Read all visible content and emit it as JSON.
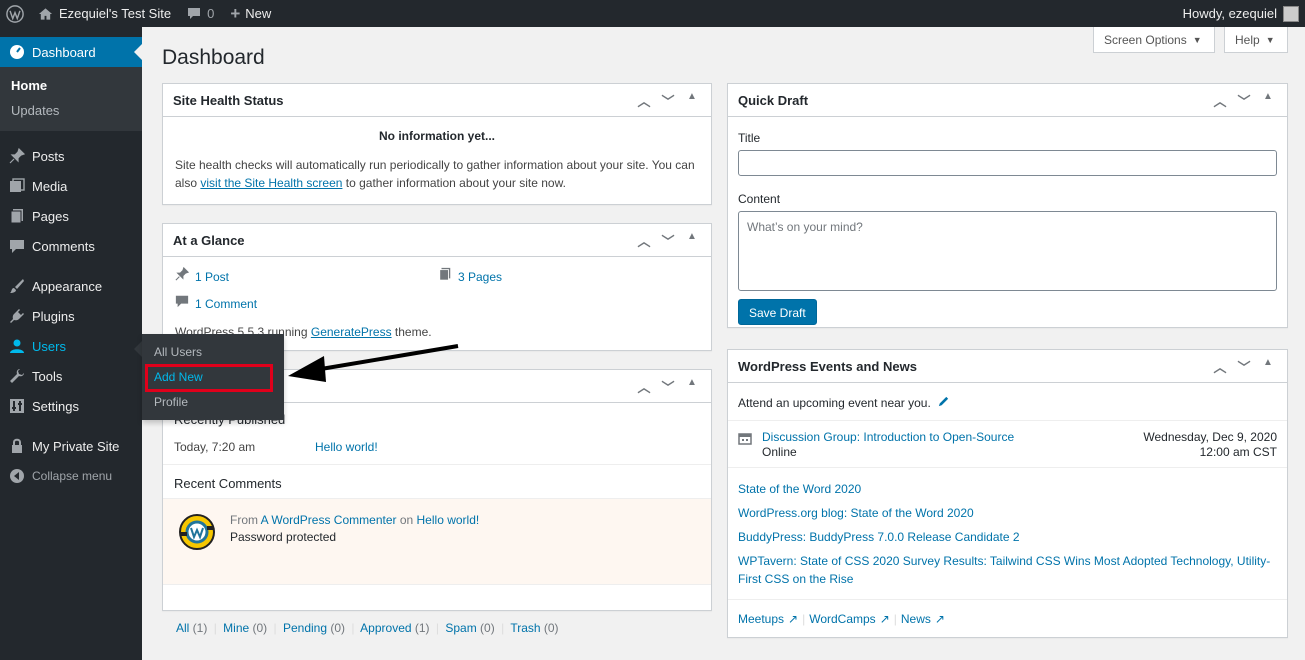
{
  "adminbar": {
    "site_name": "Ezequiel's Test Site",
    "comments_count": "0",
    "new_label": "New",
    "howdy": "Howdy, ezequiel"
  },
  "sidebar": {
    "dashboard": "Dashboard",
    "home": "Home",
    "updates": "Updates",
    "posts": "Posts",
    "media": "Media",
    "pages": "Pages",
    "comments": "Comments",
    "appearance": "Appearance",
    "plugins": "Plugins",
    "users": "Users",
    "tools": "Tools",
    "settings": "Settings",
    "private_site": "My Private Site",
    "collapse": "Collapse menu"
  },
  "users_flyout": {
    "all_users": "All Users",
    "add_new": "Add New",
    "profile": "Profile"
  },
  "header": {
    "title": "Dashboard",
    "screen_options": "Screen Options",
    "help": "Help"
  },
  "site_health": {
    "title": "Site Health Status",
    "no_info": "No information yet...",
    "text_before": "Site health checks will automatically run periodically to gather information about your site. You can also ",
    "link": "visit the Site Health screen",
    "text_after": " to gather information about your site now."
  },
  "at_a_glance": {
    "title": "At a Glance",
    "posts": "1 Post",
    "pages": "3 Pages",
    "comments": "1 Comment",
    "theme_prefix": "WordPress 5.5.3 running ",
    "theme_link": "GeneratePress",
    "theme_suffix": " theme."
  },
  "activity": {
    "recently_published": "Recently Published",
    "published_time": "Today, 7:20 am",
    "published_link": "Hello world!",
    "recent_comments": "Recent Comments",
    "comment_from": "From ",
    "commenter": "A WordPress Commenter",
    "on": " on ",
    "comment_post": "Hello world!",
    "password_protected": "Password protected",
    "filters": [
      {
        "label": "All",
        "count": " (1)"
      },
      {
        "label": "Mine",
        "count": " (0)"
      },
      {
        "label": "Pending",
        "count": " (0)"
      },
      {
        "label": "Approved",
        "count": " (1)"
      },
      {
        "label": "Spam",
        "count": " (0)"
      },
      {
        "label": "Trash",
        "count": " (0)"
      }
    ]
  },
  "quick_draft": {
    "title": "Quick Draft",
    "title_label": "Title",
    "content_label": "Content",
    "content_placeholder": "What’s on your mind?",
    "save_button": "Save Draft"
  },
  "events": {
    "title": "WordPress Events and News",
    "attend": "Attend an upcoming event near you.",
    "event_title": "Discussion Group: Introduction to Open-Source",
    "event_location": "Online",
    "event_date": "Wednesday, Dec 9, 2020",
    "event_time": "12:00 am CST",
    "news": [
      "State of the Word 2020",
      "WordPress.org blog: State of the Word 2020",
      "BuddyPress: BuddyPress 7.0.0 Release Candidate 2",
      "WPTavern: State of CSS 2020 Survey Results: Tailwind CSS Wins Most Adopted Technology, Utility-First CSS on the Rise"
    ],
    "meetups": "Meetups",
    "wordcamps": "WordCamps",
    "news_link": "News"
  }
}
